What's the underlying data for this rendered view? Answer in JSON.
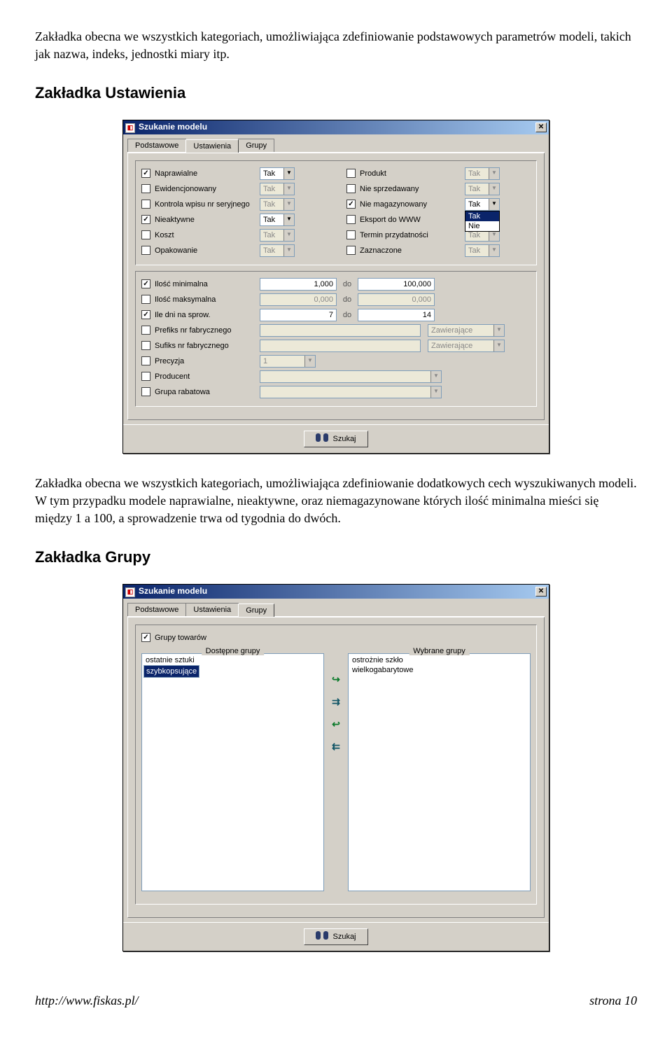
{
  "intro": "Zakładka obecna we wszystkich kategoriach, umożliwiająca zdefiniowanie podstawowych parametrów modeli, takich jak nazwa, indeks, jednostki miary itp.",
  "heading1": "Zakładka Ustawienia",
  "dialog1": {
    "title": "Szukanie modelu",
    "tabs": [
      "Podstawowe",
      "Ustawienia",
      "Grupy"
    ],
    "active_tab": 1,
    "leftRows": [
      {
        "chk": true,
        "label": "Naprawialne",
        "val": "Tak"
      },
      {
        "chk": false,
        "label": "Ewidencjonowany",
        "val": "Tak"
      },
      {
        "chk": false,
        "label": "Kontrola wpisu nr seryjnego",
        "val": "Tak"
      },
      {
        "chk": true,
        "label": "Nieaktywne",
        "val": "Tak"
      },
      {
        "chk": false,
        "label": "Koszt",
        "val": "Tak"
      },
      {
        "chk": false,
        "label": "Opakowanie",
        "val": "Tak"
      }
    ],
    "rightRows": [
      {
        "chk": false,
        "label": "Produkt",
        "val": "Tak"
      },
      {
        "chk": false,
        "label": "Nie sprzedawany",
        "val": "Tak"
      },
      {
        "chk": true,
        "label": "Nie magazynowany",
        "val": "Tak",
        "open": true,
        "opts": [
          "Tak",
          "Nie"
        ]
      },
      {
        "chk": false,
        "label": "Eksport do WWW",
        "val": "Tak"
      },
      {
        "chk": false,
        "label": "Termin przydatności",
        "val": "Tak"
      },
      {
        "chk": false,
        "label": "Zaznaczone",
        "val": "Tak"
      }
    ],
    "numeric": [
      {
        "chk": true,
        "label": "Ilość minimalna",
        "a": "1,000",
        "to": "do",
        "b": "100,000"
      },
      {
        "chk": false,
        "label": "Ilość maksymalna",
        "a": "0,000",
        "to": "do",
        "b": "0,000"
      },
      {
        "chk": true,
        "label": "Ile dni na sprow.",
        "a": "7",
        "to": "do",
        "b": "14"
      }
    ],
    "txtRows": [
      {
        "chk": false,
        "label": "Prefiks nr fabrycznego",
        "val": "",
        "sel": "Zawierające"
      },
      {
        "chk": false,
        "label": "Sufiks nr fabrycznego",
        "val": "",
        "sel": "Zawierające"
      }
    ],
    "single": [
      {
        "chk": false,
        "label": "Precyzja",
        "val": "1",
        "kind": "sel-narrow"
      },
      {
        "chk": false,
        "label": "Producent",
        "val": "",
        "kind": "sel-wide"
      },
      {
        "chk": false,
        "label": "Grupa rabatowa",
        "val": "",
        "kind": "sel-wide"
      }
    ],
    "search": "Szukaj"
  },
  "between_text": "Zakładka obecna we wszystkich kategoriach, umożliwiająca zdefiniowanie dodatkowych cech wyszukiwanych modeli. W tym przypadku modele naprawialne, nieaktywne, oraz niemagazynowane których ilość minimalna mieści się między 1 a 100, a sprowadzenie trwa od tygodnia do dwóch.",
  "heading2": "Zakładka Grupy",
  "dialog2": {
    "title": "Szukanie modelu",
    "tabs": [
      "Podstawowe",
      "Ustawienia",
      "Grupy"
    ],
    "active_tab": 2,
    "chk_label": "Grupy towarów",
    "avail_head": "Dostępne grupy",
    "sel_head": "Wybrane grupy",
    "avail_items": [
      "ostatnie sztuki",
      "szybkopsujące"
    ],
    "sel_items": [
      "ostrożnie szkło",
      "wielkogabarytowe"
    ],
    "search": "Szukaj"
  },
  "footer_left": "http://www.fiskas.pl/",
  "footer_right": "strona 10"
}
